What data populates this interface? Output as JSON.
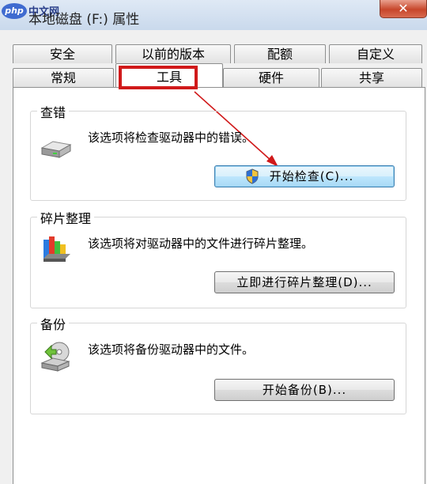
{
  "window": {
    "logo_text": "php",
    "site_text": "中文网",
    "title": "本地磁盘 (F:) 属性",
    "close_symbol": "✕"
  },
  "tabs_back": [
    "安全",
    "以前的版本",
    "配额",
    "自定义"
  ],
  "tabs_front": [
    "常规",
    "工具",
    "硬件",
    "共享"
  ],
  "active_tab": "工具",
  "sections": {
    "error_check": {
      "title": "查错",
      "description": "该选项将检查驱动器中的错误。",
      "button": "开始检查(C)..."
    },
    "defrag": {
      "title": "碎片整理",
      "description": "该选项将对驱动器中的文件进行碎片整理。",
      "button": "立即进行碎片整理(D)..."
    },
    "backup": {
      "title": "备份",
      "description": "该选项将备份驱动器中的文件。",
      "button": "开始备份(B)..."
    }
  },
  "colors": {
    "highlight_red": "#d0191a",
    "focus_blue": "#3c7fb1"
  }
}
